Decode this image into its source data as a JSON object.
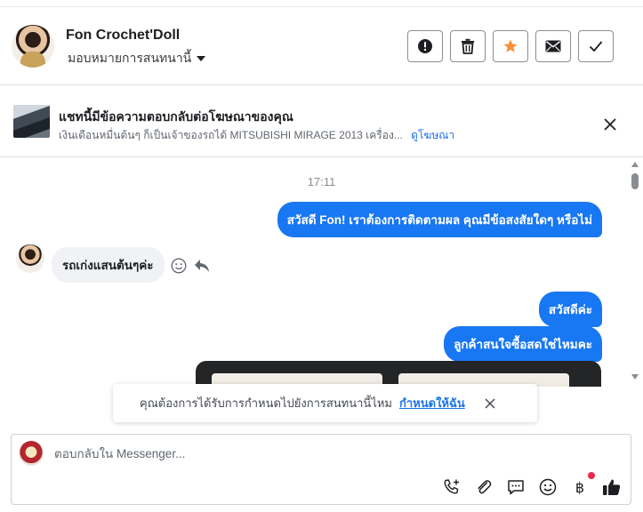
{
  "header": {
    "contact_name": "Fon Crochet'Doll",
    "assign_label": "มอบหมายการสนทนานี้",
    "actions": [
      {
        "name": "mark-spam-button",
        "icon": "exclamation-circle-icon"
      },
      {
        "name": "delete-button",
        "icon": "trash-icon"
      },
      {
        "name": "star-button",
        "icon": "star-icon",
        "color": "#f7923b"
      },
      {
        "name": "mark-unread-button",
        "icon": "envelope-icon"
      },
      {
        "name": "mark-done-button",
        "icon": "check-icon"
      }
    ]
  },
  "ad_banner": {
    "title": "แชทนี้มีข้อความตอบกลับต่อโฆษณาของคุณ",
    "subtitle": "เงินเดือนหมื่นต้นๆ ก็เป็นเจ้าของรถได้ MITSUBISHI MIRAGE 2013 เครื่อง...",
    "link_label": "ดูโฆษณา"
  },
  "chat": {
    "timestamp": "17:11",
    "messages": [
      {
        "from": "page",
        "text": "สวัสดี Fon! เราต้องการติดตามผล คุณมีข้อสงสัยใดๆ หรือไม่"
      },
      {
        "from": "customer",
        "text": "รถเก่งแสนต้นๆค่ะ"
      },
      {
        "from": "page",
        "text": "สวัสดีค่ะ"
      },
      {
        "from": "page",
        "text": "ลูกค้าสนใจซื้อสดใช่ไหมคะ"
      }
    ]
  },
  "toast": {
    "text": "คุณต้องการได้รับการกำหนดไปยังการสนทนานี้ไหม",
    "link_label": "กำหนดให้ฉัน"
  },
  "composer": {
    "placeholder": "ตอบกลับใน Messenger...",
    "baht_symbol": "฿",
    "tools": [
      "phone-plus-icon",
      "paperclip-icon",
      "chat-bubble-icon",
      "smiley-icon",
      "baht-icon",
      "thumbs-up-icon"
    ]
  },
  "colors": {
    "brand_blue": "#1877f2",
    "link_blue": "#1a73e8",
    "star_orange": "#f7923b",
    "notification_red": "#f02849"
  }
}
